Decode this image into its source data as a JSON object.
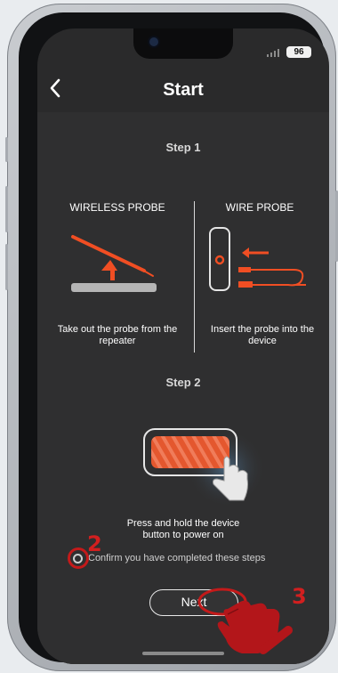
{
  "status_bar": {
    "battery": "96"
  },
  "header": {
    "title": "Start",
    "back_icon": "chevron-left-icon"
  },
  "step1": {
    "label": "Step 1",
    "wireless": {
      "title": "WIRELESS PROBE",
      "desc": "Take out the probe from the repeater"
    },
    "wire": {
      "title": "WIRE PROBE",
      "desc": "Insert the probe into the device"
    }
  },
  "step2": {
    "label": "Step 2",
    "desc": "Press and hold the device button to power on"
  },
  "confirm": {
    "label": "Confirm you have completed these steps"
  },
  "next": {
    "label": "Next"
  },
  "annotations": {
    "a2": "2",
    "a3": "3"
  },
  "colors": {
    "accent": "#f04e23",
    "annotation": "#d21f1f",
    "background": "#2f2f30"
  }
}
